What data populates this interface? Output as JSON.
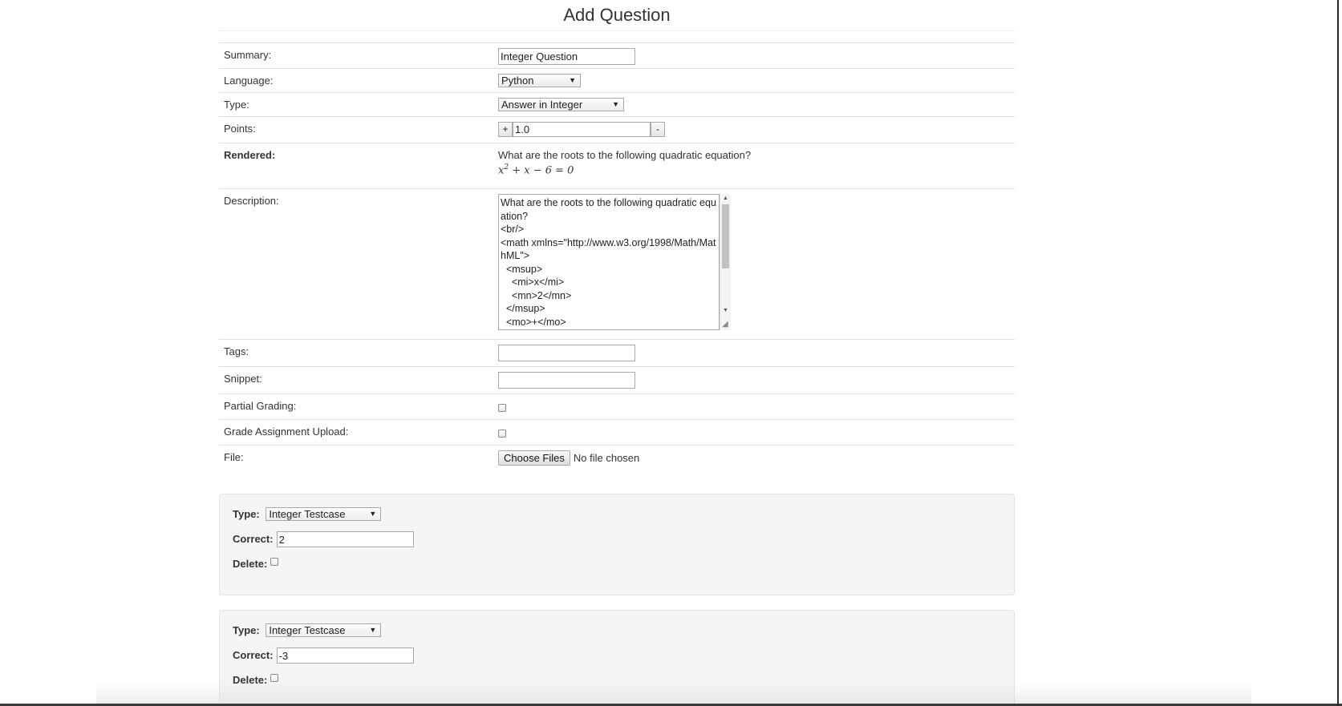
{
  "page": {
    "title": "Add Question"
  },
  "form": {
    "summary": {
      "label": "Summary:",
      "value": "Integer Question"
    },
    "language": {
      "label": "Language:",
      "selected": "Python"
    },
    "type": {
      "label": "Type:",
      "selected": "Answer in Integer"
    },
    "points": {
      "label": "Points:",
      "value": "1.0",
      "increment_label": "+",
      "decrement_label": "-"
    },
    "rendered": {
      "label": "Rendered:",
      "text": "What are the roots to the following quadratic equation?",
      "math_base": "x",
      "math_exp": "2",
      "math_rest": " + x − 6 = 0"
    },
    "description": {
      "label": "Description:",
      "value": "What are the roots to the following quadratic equation?\n<br/>\n<math xmlns=\"http://www.w3.org/1998/Math/MathML\">\n  <msup>\n    <mi>x</mi>\n    <mn>2</mn>\n  </msup>\n  <mo>+</mo>"
    },
    "tags": {
      "label": "Tags:",
      "value": ""
    },
    "snippet": {
      "label": "Snippet:",
      "value": ""
    },
    "partial_grading": {
      "label": "Partial Grading:",
      "checked": false
    },
    "grade_assignment_upload": {
      "label": "Grade Assignment Upload:",
      "checked": false
    },
    "file": {
      "label": "File:",
      "button_label": "Choose Files",
      "status": "No file chosen"
    }
  },
  "testcases": [
    {
      "type_label": "Type:",
      "type_selected": "Integer Testcase",
      "correct_label": "Correct:",
      "correct_value": "2",
      "delete_label": "Delete:"
    },
    {
      "type_label": "Type:",
      "type_selected": "Integer Testcase",
      "correct_label": "Correct:",
      "correct_value": "-3",
      "delete_label": "Delete:"
    }
  ],
  "icons": {
    "dropdown_arrow": "▼",
    "scroll_up": "▲",
    "scroll_down": "▼",
    "resize_grip": "◢"
  }
}
